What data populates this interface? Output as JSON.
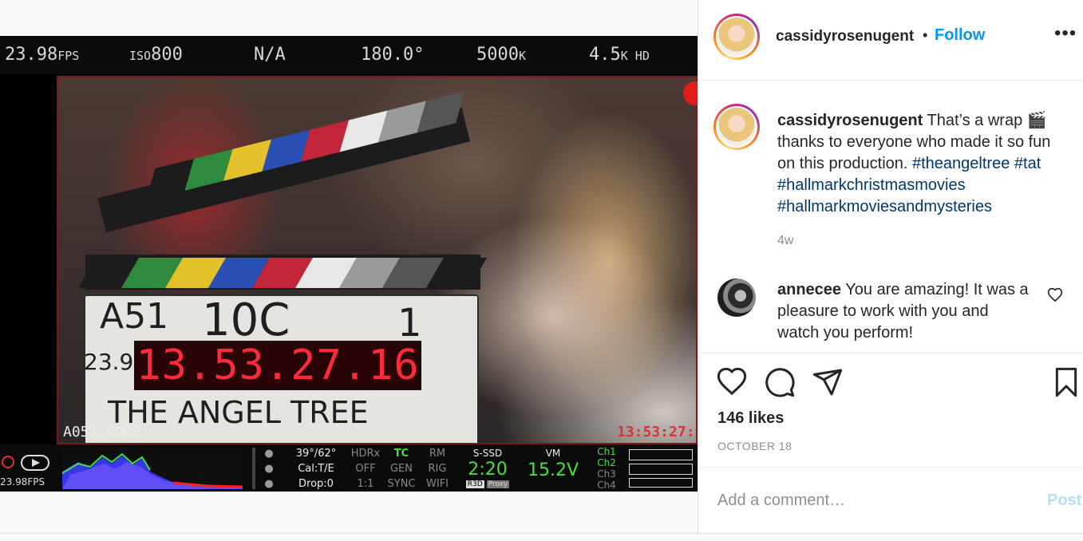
{
  "media": {
    "camera_bar": {
      "fps": "23.98",
      "fps_unit": "FPS",
      "iso": "800",
      "iso_label": "ISO",
      "na": "N/A",
      "shutter": "180.0°",
      "wb": "5000",
      "wb_unit": "K",
      "resolution": "4.5",
      "resolution_unit": "K HD"
    },
    "clapper": {
      "roll": "A51",
      "scene": "10C",
      "take": "1",
      "fps": "23.98",
      "timecode": "13.53.27.16",
      "title": "THE ANGEL TREE"
    },
    "clip_name": "A051_C008",
    "overlay_timecode": "13:53:27:",
    "status": {
      "left_fps": "23.98FPS",
      "temp": "39°/62°",
      "cal": "Cal:T/E",
      "drop": "Drop:0",
      "hdrx": "HDRx",
      "hdrx_val": "OFF",
      "ratio": "1:1",
      "tc": "TC",
      "tc_gen": "GEN",
      "sync": "SYNC",
      "rm": "RM",
      "rig": "RIG",
      "wifi": "WIFI",
      "media": "S-SSD",
      "media_time": "2:20",
      "r3d": "R3D",
      "proxy": "Proxy",
      "vm": "VM",
      "voltage": "15.2V",
      "ch1": "Ch1",
      "ch2": "Ch2",
      "ch3": "Ch3",
      "ch4": "Ch4"
    }
  },
  "post": {
    "author": "cassidyrosenugent",
    "follow_separator": "•",
    "follow_label": "Follow",
    "more_label": "•••",
    "caption_text": "That’s a wrap 🎬 thanks to everyone who made it so fun on this production.",
    "hashtags": [
      "#theangeltree",
      "#tat",
      "#hallmarkchristmasmovies",
      "#hallmarkmoviesandmysteries"
    ],
    "age": "4w",
    "comment": {
      "author": "annecee",
      "text": "You are amazing! It was a pleasure to work with you and watch you perform!"
    },
    "likes": "146 likes",
    "date": "OCTOBER 18",
    "add_comment_placeholder": "Add a comment…",
    "post_button": "Post"
  },
  "colors": {
    "accent": "#0095f6",
    "hashtag": "#00376b",
    "muted": "#8e8e8e",
    "post_disabled": "#b2dffc",
    "timecode_red": "#ff2a3a",
    "status_green": "#46e03c"
  },
  "icons": [
    "heart-icon",
    "comment-icon",
    "share-icon",
    "bookmark-icon",
    "more-options-icon",
    "small-heart-icon"
  ]
}
